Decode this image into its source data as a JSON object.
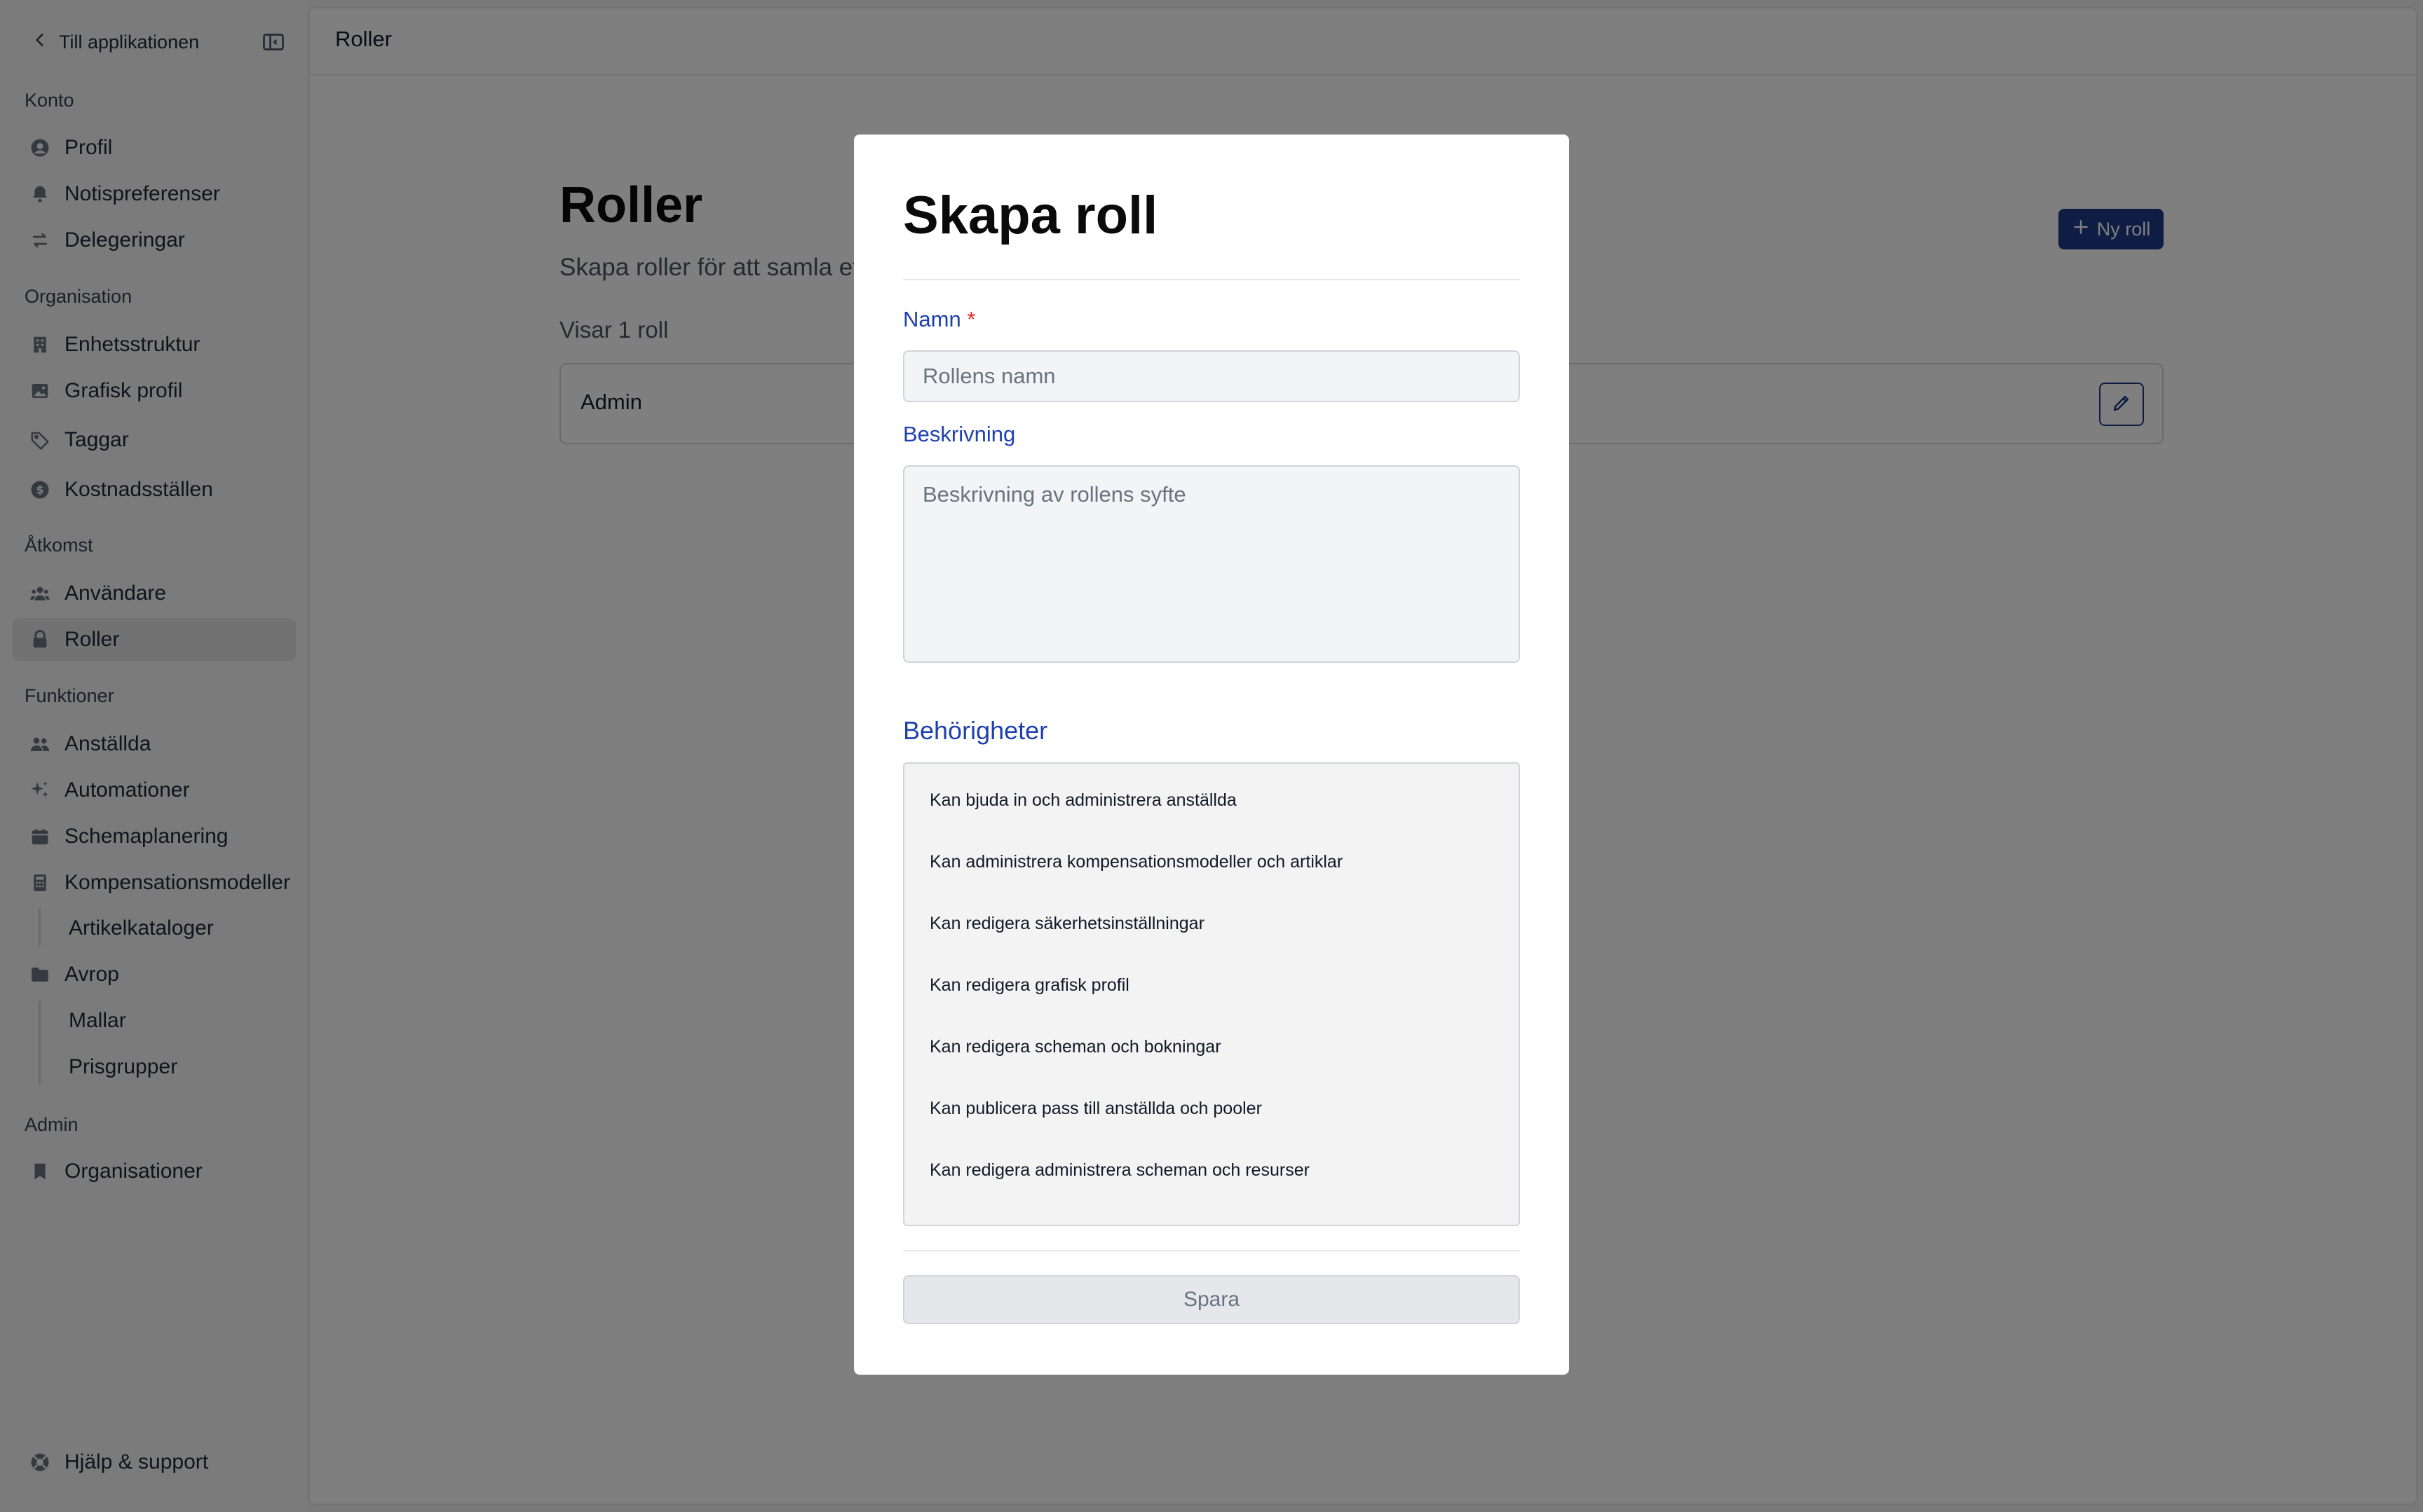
{
  "sidebar": {
    "back_label": "Till applikationen",
    "groups": [
      {
        "title": "Konto",
        "items": [
          "Profil",
          "Notispreferenser",
          "Delegeringar"
        ]
      },
      {
        "title": "Organisation",
        "items": [
          "Enhetsstruktur",
          "Grafisk profil",
          "Taggar",
          "Kostnadsställen"
        ]
      },
      {
        "title": "Åtkomst",
        "items": [
          "Användare",
          "Roller"
        ]
      },
      {
        "title": "Funktioner",
        "items": [
          "Anställda",
          "Automationer",
          "Schemaplanering",
          "Kompensationsmodeller"
        ],
        "subitems_kompensation": [
          "Artikelkataloger"
        ],
        "items2": [
          "Avrop"
        ],
        "subitems_avrop": [
          "Mallar",
          "Prisgrupper"
        ]
      },
      {
        "title": "Admin",
        "items": [
          "Organisationer"
        ]
      }
    ],
    "help_label": "Hjälp & support",
    "active_item": "Roller"
  },
  "main": {
    "breadcrumb": "Roller",
    "title": "Roller",
    "subtitle": "Skapa roller för att samla et",
    "count": "Visar 1 roll",
    "new_role_label": "Ny roll",
    "roles": [
      {
        "name": "Admin"
      }
    ]
  },
  "modal": {
    "title": "Skapa roll",
    "name_label": "Namn",
    "required_mark": "*",
    "name_placeholder": "Rollens namn",
    "description_label": "Beskrivning",
    "description_placeholder": "Beskrivning av rollens syfte",
    "permissions_title": "Behörigheter",
    "permissions": [
      "Kan bjuda in och administrera anställda",
      "Kan administrera kompensationsmodeller och artiklar",
      "Kan redigera säkerhetsinställningar",
      "Kan redigera grafisk profil",
      "Kan redigera scheman och bokningar",
      "Kan publicera pass till anställda och pooler",
      "Kan redigera administrera scheman och resurser"
    ],
    "save_label": "Spara"
  },
  "colors": {
    "accent": "#1e3a8a",
    "label_blue": "#1e40af",
    "required": "#dc2626",
    "overlay": "rgba(0,0,0,0.5)"
  }
}
